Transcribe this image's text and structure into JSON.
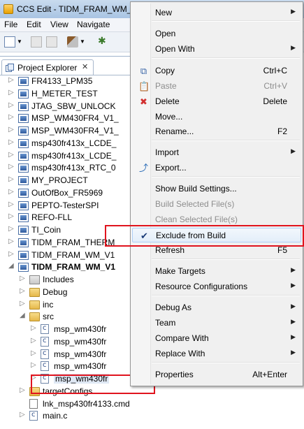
{
  "window": {
    "title": "CCS Edit - TIDM_FRAM_WM_V1"
  },
  "menubar": {
    "file": "File",
    "edit": "Edit",
    "view": "View",
    "navigate": "Navigate"
  },
  "explorer": {
    "tab_label": "Project Explorer",
    "tab_close": "✕",
    "items": [
      {
        "label": "FR4133_LPM35",
        "type": "project"
      },
      {
        "label": "H_METER_TEST",
        "type": "project"
      },
      {
        "label": "JTAG_SBW_UNLOCK",
        "type": "project"
      },
      {
        "label": "MSP_WM430FR4_V1_",
        "type": "project"
      },
      {
        "label": "MSP_WM430FR4_V1_",
        "type": "project"
      },
      {
        "label": "msp430fr413x_LCDE_",
        "type": "project"
      },
      {
        "label": "msp430fr413x_LCDE_",
        "type": "project"
      },
      {
        "label": "msp430fr413x_RTC_0",
        "type": "project"
      },
      {
        "label": "MY_PROJECT",
        "type": "project"
      },
      {
        "label": "OutOfBox_FR5969",
        "type": "project"
      },
      {
        "label": "PEPTO-TesterSPI",
        "type": "project"
      },
      {
        "label": "REFO-FLL",
        "type": "project"
      },
      {
        "label": "TI_Coin",
        "type": "project"
      },
      {
        "label": "TIDM_FRAM_THERM",
        "type": "project"
      },
      {
        "label": "TIDM_FRAM_WM_V1",
        "type": "project"
      },
      {
        "label": "TIDM_FRAM_WM_V1",
        "type": "project",
        "open": true
      },
      {
        "label": "Includes",
        "type": "includes"
      },
      {
        "label": "Debug",
        "type": "folder"
      },
      {
        "label": "inc",
        "type": "folder"
      },
      {
        "label": "src",
        "type": "folder",
        "open": true
      },
      {
        "label": "msp_wm430fr",
        "type": "file"
      },
      {
        "label": "msp_wm430fr",
        "type": "file"
      },
      {
        "label": "msp_wm430fr",
        "type": "file"
      },
      {
        "label": "msp_wm430fr",
        "type": "file"
      },
      {
        "label": "msp_wm430fr",
        "type": "file",
        "excluded": true
      },
      {
        "label": "targetConfigs",
        "type": "folder"
      },
      {
        "label": "lnk_msp430fr4133.cmd",
        "type": "cmd"
      },
      {
        "label": "main.c",
        "type": "file"
      }
    ]
  },
  "context_menu": {
    "items": [
      {
        "label": "New",
        "submenu": true
      },
      {
        "sep": true
      },
      {
        "label": "Open"
      },
      {
        "label": "Open With",
        "submenu": true
      },
      {
        "sep": true
      },
      {
        "label": "Copy",
        "shortcut": "Ctrl+C",
        "icon": "copy-icon"
      },
      {
        "label": "Paste",
        "shortcut": "Ctrl+V",
        "icon": "paste-icon",
        "disabled": true
      },
      {
        "label": "Delete",
        "shortcut": "Delete",
        "icon": "delete-icon"
      },
      {
        "label": "Move..."
      },
      {
        "label": "Rename...",
        "shortcut": "F2"
      },
      {
        "sep": true
      },
      {
        "label": "Import",
        "submenu": true
      },
      {
        "label": "Export...",
        "icon": "export-icon"
      },
      {
        "sep": true
      },
      {
        "label": "Show Build Settings..."
      },
      {
        "label": "Build Selected File(s)",
        "disabled": true
      },
      {
        "label": "Clean Selected File(s)",
        "disabled": true
      },
      {
        "label": "Exclude from Build",
        "checked": true,
        "highlight": true
      },
      {
        "label": "Refresh",
        "shortcut": "F5"
      },
      {
        "sep": true
      },
      {
        "label": "Make Targets",
        "submenu": true
      },
      {
        "label": "Resource Configurations",
        "submenu": true
      },
      {
        "sep": true
      },
      {
        "label": "Debug As",
        "submenu": true
      },
      {
        "label": "Team",
        "submenu": true
      },
      {
        "label": "Compare With",
        "submenu": true
      },
      {
        "label": "Replace With",
        "submenu": true
      },
      {
        "sep": true
      },
      {
        "label": "Properties",
        "shortcut": "Alt+Enter"
      }
    ]
  },
  "colors": {
    "callout_red": "#e0141e",
    "menu_bg": "#f0f0f0",
    "highlight": "#e3eefa"
  }
}
